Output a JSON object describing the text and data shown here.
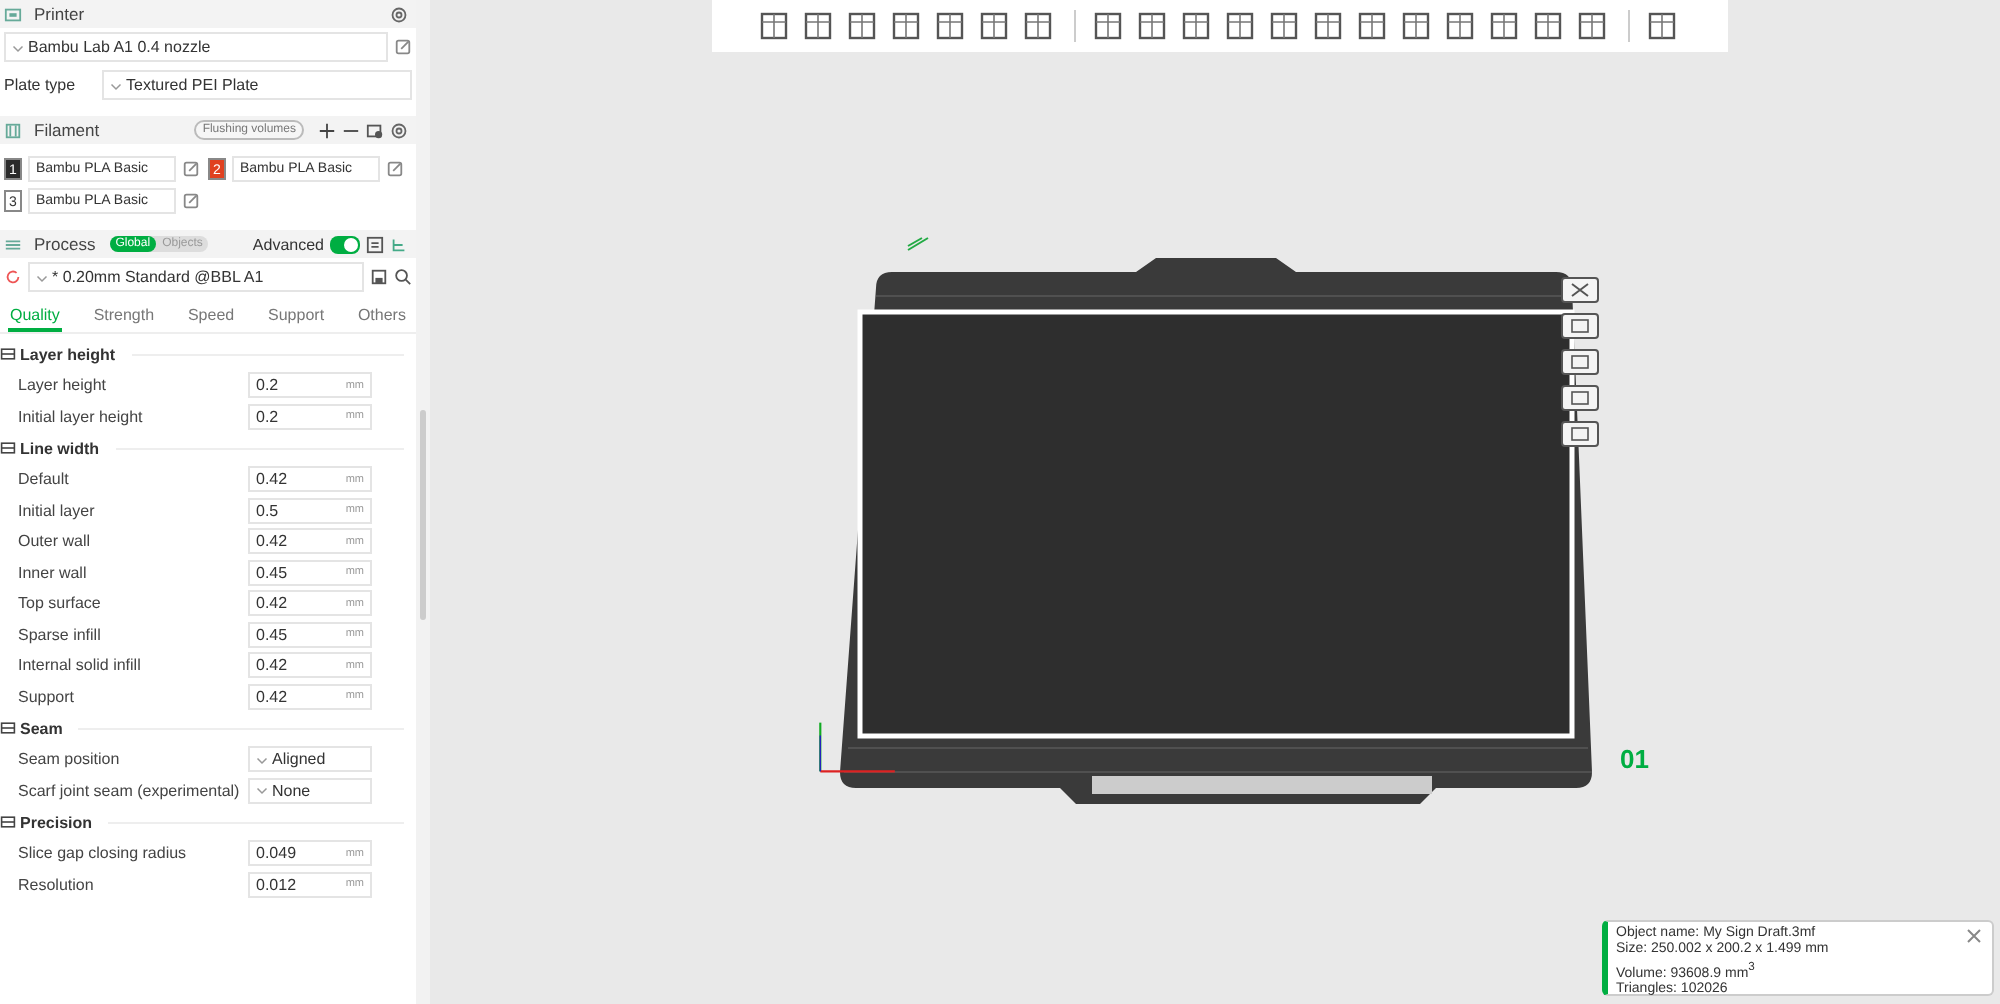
{
  "printer": {
    "title": "Printer",
    "preset": "Bambu Lab A1 0.4 nozzle",
    "plate_label": "Plate type",
    "plate_type": "Textured PEI Plate"
  },
  "filament": {
    "title": "Filament",
    "flushing_button": "Flushing volumes",
    "items": [
      {
        "number": "1",
        "name": "Bambu PLA Basic",
        "color": "#2b2b2b"
      },
      {
        "number": "2",
        "name": "Bambu PLA Basic",
        "color": "#e0401f"
      },
      {
        "number": "3",
        "name": "Bambu PLA Basic",
        "color": "#ffffff"
      }
    ]
  },
  "process": {
    "title": "Process",
    "scope_tabs": [
      {
        "label": "Global",
        "selected": true
      },
      {
        "label": "Objects",
        "selected": false
      }
    ],
    "advanced_label": "Advanced",
    "advanced_on": true,
    "preset": "* 0.20mm Standard @BBL A1",
    "tabs": [
      {
        "label": "Quality",
        "selected": true
      },
      {
        "label": "Strength",
        "selected": false
      },
      {
        "label": "Speed",
        "selected": false
      },
      {
        "label": "Support",
        "selected": false
      },
      {
        "label": "Others",
        "selected": false
      }
    ],
    "groups": [
      {
        "title": "Layer height",
        "rows": [
          {
            "kind": "number",
            "label": "Layer height",
            "value": "0.2",
            "unit": "mm"
          },
          {
            "kind": "number",
            "label": "Initial layer height",
            "value": "0.2",
            "unit": "mm"
          }
        ]
      },
      {
        "title": "Line width",
        "rows": [
          {
            "kind": "number",
            "label": "Default",
            "value": "0.42",
            "unit": "mm"
          },
          {
            "kind": "number",
            "label": "Initial layer",
            "value": "0.5",
            "unit": "mm"
          },
          {
            "kind": "number",
            "label": "Outer wall",
            "value": "0.42",
            "unit": "mm"
          },
          {
            "kind": "number",
            "label": "Inner wall",
            "value": "0.45",
            "unit": "mm"
          },
          {
            "kind": "number",
            "label": "Top surface",
            "value": "0.42",
            "unit": "mm"
          },
          {
            "kind": "number",
            "label": "Sparse infill",
            "value": "0.45",
            "unit": "mm"
          },
          {
            "kind": "number",
            "label": "Internal solid infill",
            "value": "0.42",
            "unit": "mm"
          },
          {
            "kind": "number",
            "label": "Support",
            "value": "0.42",
            "unit": "mm"
          }
        ]
      },
      {
        "title": "Seam",
        "rows": [
          {
            "kind": "select",
            "label": "Seam position",
            "value": "Aligned"
          },
          {
            "kind": "select",
            "label": "Scarf joint seam (experimental)",
            "value": "None"
          }
        ]
      },
      {
        "title": "Precision",
        "rows": [
          {
            "kind": "number",
            "label": "Slice gap closing radius",
            "value": "0.049",
            "unit": "mm"
          },
          {
            "kind": "number",
            "label": "Resolution",
            "value": "0.012",
            "unit": "mm"
          }
        ]
      }
    ]
  },
  "viewport": {
    "plate_number": "01"
  },
  "object_info": {
    "lines": [
      "Object name: My Sign Draft.3mf",
      "Size: 250.002 x 200.2 x 1.499 mm",
      "Volume: 93608.9 mm$^{3}$",
      "Triangles: 102026"
    ]
  }
}
